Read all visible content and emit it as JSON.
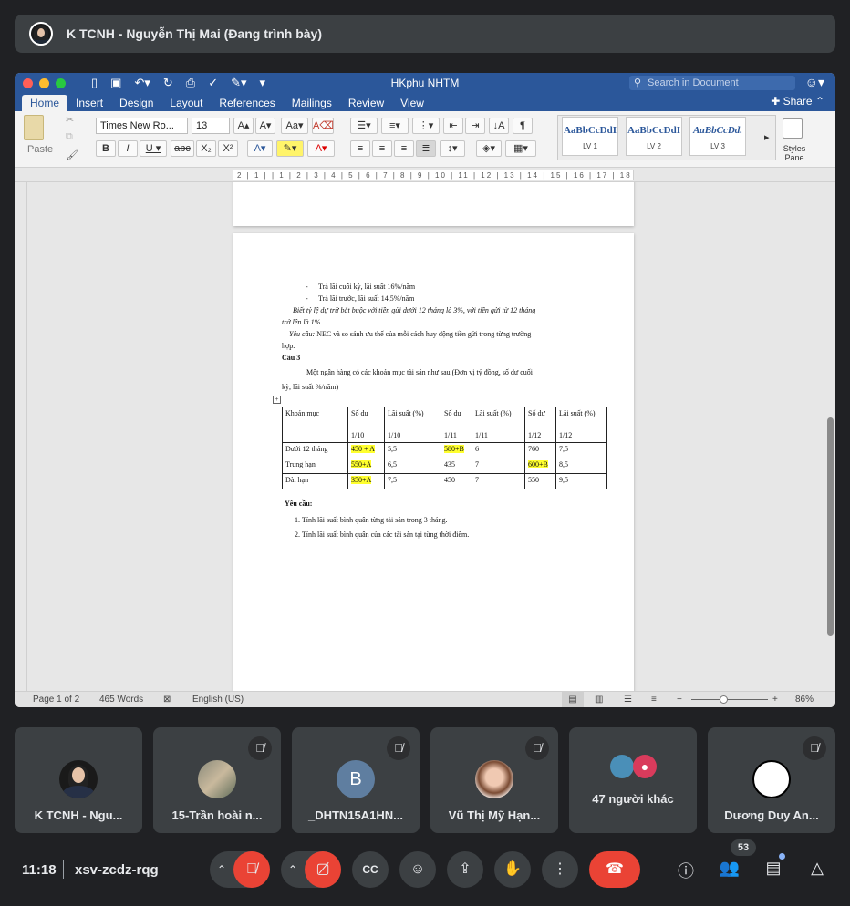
{
  "meet": {
    "presenter_title": "K TCNH - Nguyễn Thị Mai (Đang trình bày)",
    "time": "11:18",
    "meeting_code": "xsv-zcdz-rqg",
    "participants_count": "53",
    "participants": [
      {
        "name": "K TCNH - Ngu...",
        "muted": false
      },
      {
        "name": "15-Trần hoài n...",
        "muted": true
      },
      {
        "name": "_DHTN15A1HN...",
        "muted": true,
        "initial": "B"
      },
      {
        "name": "Vũ Thị Mỹ Hạn...",
        "muted": true
      },
      {
        "name": "47 người khác",
        "muted": false
      },
      {
        "name": "Dương Duy An...",
        "muted": true
      }
    ]
  },
  "word": {
    "doc_title": "HKphu NHTM",
    "search_placeholder": "Search in Document",
    "share_label": "Share",
    "tabs": [
      "Home",
      "Insert",
      "Design",
      "Layout",
      "References",
      "Mailings",
      "Review",
      "View"
    ],
    "font_name": "Times New Ro...",
    "font_size": "13",
    "paste_label": "Paste",
    "styles": [
      {
        "preview": "AaBbCcDdI",
        "name": "LV 1"
      },
      {
        "preview": "AaBbCcDdI",
        "name": "LV 2"
      },
      {
        "preview": "AaBbCcDd.",
        "name": "LV 3"
      }
    ],
    "styles_pane": "Styles Pane",
    "ruler_text": "2 | 1 |   | 1 | 2 | 3 | 4 | 5 | 6 | 7 | 8 | 9 | 10 | 11 | 12 | 13 | 14 | 15 | 16 | 17 | 18",
    "status": {
      "page": "Page 1 of 2",
      "words": "465 Words",
      "language": "English (US)",
      "zoom": "86%"
    },
    "document": {
      "bullet1": "Trả lãi cuối kỳ, lãi suất 16%/năm",
      "bullet2": "Trả lãi trước, lãi suất 14,5%/năm",
      "note_line1": "Biết tỷ lệ dự trữ bắt buộc với tiền gửi dưới 12 tháng là 3%, với tiền gửi từ 12 tháng",
      "note_line2": "trở lên là 1%.",
      "req_label": "Yêu cầu:",
      "req_text": " NEC và so sánh ưu thế của mỗi cách huy động tiền gửi trong từng trường",
      "req_text2": "hợp.",
      "cau3": "Câu 3",
      "intro1": "Một ngân hàng có các khoản mục tài sản như sau (Đơn vị tỷ đồng, số dư cuối",
      "intro2": "kỳ, lãi suất %/năm)",
      "table": {
        "header1": [
          "Khoản mục",
          "Số dư",
          "Lãi suất (%)",
          "Số dư",
          "Lãi suất (%)",
          "Số dư",
          "Lãi suất (%)"
        ],
        "header2": [
          "",
          "1/10",
          "1/10",
          "1/11",
          "1/11",
          "1/12",
          "1/12"
        ],
        "rows": [
          [
            "Dưới 12 tháng",
            "450 + A",
            "5,5",
            "580+B",
            "6",
            "760",
            "7,5"
          ],
          [
            "Trung hạn",
            "550+A",
            "6,5",
            "435",
            "7",
            "600+B",
            "8,5"
          ],
          [
            "Dài hạn",
            "350+A",
            "7,5",
            "450",
            "7",
            "550",
            "9,5"
          ]
        ]
      },
      "yc_label": "Yêu cầu:",
      "yc1": "1.   Tính lãi suất bình quân từng tài sản trong 3 tháng.",
      "yc2": "2.   Tính lãi suất bình quân của các tài sản tại từng thời điểm."
    }
  }
}
